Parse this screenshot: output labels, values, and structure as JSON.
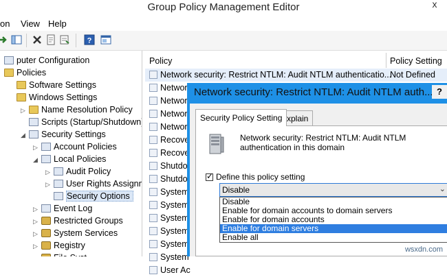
{
  "window": {
    "title": "Group Policy Management Editor",
    "close_glyph": "x"
  },
  "menu": [
    "on",
    "View",
    "Help"
  ],
  "tree": [
    {
      "label": "puter Configuration",
      "icon": "computer-icon",
      "arrow": "",
      "indent": 0
    },
    {
      "label": "Policies",
      "icon": "folder-icon",
      "arrow": "",
      "indent": 0
    },
    {
      "label": "Software Settings",
      "icon": "folder-icon",
      "arrow": "",
      "indent": 1
    },
    {
      "label": "Windows Settings",
      "icon": "folder-icon",
      "arrow": "",
      "indent": 1
    },
    {
      "label": "Name Resolution Policy",
      "icon": "folder-icon",
      "arrow": "▷",
      "indent": 2
    },
    {
      "label": "Scripts (Startup/Shutdown)",
      "icon": "script-icon",
      "arrow": "",
      "indent": 2
    },
    {
      "label": "Security Settings",
      "icon": "security-icon",
      "arrow": "◢",
      "indent": 2
    },
    {
      "label": "Account Policies",
      "icon": "policy-icon",
      "arrow": "▷",
      "indent": 3
    },
    {
      "label": "Local Policies",
      "icon": "policy-icon",
      "arrow": "◢",
      "indent": 3
    },
    {
      "label": "Audit Policy",
      "icon": "policy-icon",
      "arrow": "▷",
      "indent": 4
    },
    {
      "label": "User Rights Assignme",
      "icon": "policy-icon",
      "arrow": "▷",
      "indent": 4
    },
    {
      "label": "Security Options",
      "icon": "policy-icon",
      "arrow": "",
      "indent": 4,
      "selected": true
    },
    {
      "label": "Event Log",
      "icon": "policy-icon",
      "arrow": "▷",
      "indent": 3
    },
    {
      "label": "Restricted Groups",
      "icon": "lock-folder-icon",
      "arrow": "▷",
      "indent": 3
    },
    {
      "label": "System Services",
      "icon": "lock-folder-icon",
      "arrow": "▷",
      "indent": 3
    },
    {
      "label": "Registry",
      "icon": "lock-folder-icon",
      "arrow": "▷",
      "indent": 3
    },
    {
      "label": "File Syst",
      "icon": "lock-folder-icon",
      "arrow": "▷",
      "indent": 3
    }
  ],
  "list": {
    "col_policy": "Policy",
    "col_setting": "Policy Setting",
    "rows": [
      {
        "name": "Network security: Restrict NTLM: Audit NTLM authenticatio...",
        "setting": "Not Defined",
        "highlight": true
      },
      {
        "name": "Networ",
        "setting": ""
      },
      {
        "name": "Networ",
        "setting": ""
      },
      {
        "name": "Networ",
        "setting": ""
      },
      {
        "name": "Networ",
        "setting": ""
      },
      {
        "name": "Recove",
        "setting": ""
      },
      {
        "name": "Recove",
        "setting": ""
      },
      {
        "name": "Shutdo",
        "setting": ""
      },
      {
        "name": "Shutdo",
        "setting": ""
      },
      {
        "name": "System",
        "setting": ""
      },
      {
        "name": "System",
        "setting": ""
      },
      {
        "name": "System",
        "setting": ""
      },
      {
        "name": "System",
        "setting": ""
      },
      {
        "name": "System",
        "setting": ""
      },
      {
        "name": "System",
        "setting": ""
      },
      {
        "name": "User Ac",
        "setting": ""
      }
    ]
  },
  "dialog": {
    "title": "Network security: Restrict NTLM: Audit NTLM auth...",
    "help_glyph": "?",
    "tabs": [
      "Security Policy Setting",
      "Explain"
    ],
    "description": "Network security: Restrict NTLM: Audit NTLM authentication in this domain",
    "define_label": "Define this policy setting",
    "define_checked": true,
    "selected_value": "Disable",
    "options": [
      "Disable",
      "Enable for domain accounts to domain servers",
      "Enable for domain accounts",
      "Enable for domain servers",
      "Enable all"
    ],
    "highlighted_option": "Enable for domain servers"
  },
  "watermark": "wsxdn.com"
}
